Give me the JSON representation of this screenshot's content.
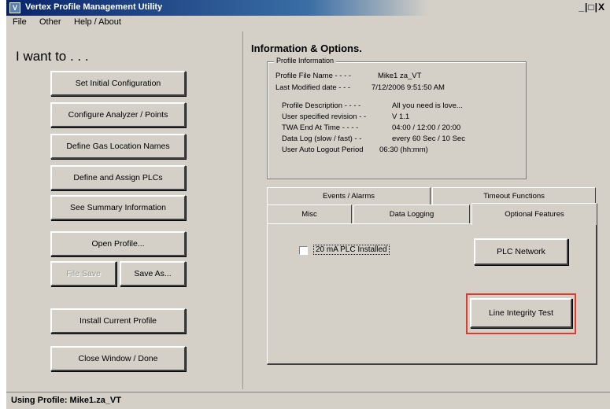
{
  "window": {
    "title": "Vertex Profile Management Utility",
    "controls": "_|□|X"
  },
  "menu": [
    {
      "label": "File"
    },
    {
      "label": "Other"
    },
    {
      "label": "Help / About"
    }
  ],
  "left": {
    "heading": "I want to . . .",
    "buttons": {
      "set_initial": "Set Initial Configuration",
      "configure": "Configure Analyzer / Points",
      "define_gas": "Define Gas Location Names",
      "define_plcs": "Define and Assign PLCs",
      "summary": "See Summary Information",
      "open_profile": "Open Profile...",
      "file_save": "File Save",
      "save_as": "Save As...",
      "install": "Install Current Profile",
      "close": "Close Window / Done"
    }
  },
  "right": {
    "title": "Information & Options.",
    "profile_info": {
      "legend": "Profile Information",
      "file_name_label": "Profile File Name - - - -",
      "file_name_value": "Mike1 za_VT",
      "modified_label": "Last Modified date - - -",
      "modified_value": "7/12/2006 9:51:50 AM",
      "description_label": "Profile Description - - - -",
      "description_value": "All you need is love...",
      "revision_label": "User specified revision - -",
      "revision_value": "V 1.1",
      "twa_label": "TWA End At Time - - - -",
      "twa_value": "04:00  /  12:00  /  20:00",
      "datalog_label": "Data Log (slow / fast) - -",
      "datalog_value": "every 60 Sec / 10 Sec",
      "logout_label": "User Auto Logout Period",
      "logout_value": "06:30 (hh:mm)"
    },
    "tabs": {
      "events": "Events / Alarms",
      "timeout": "Timeout Functions",
      "misc": "Misc",
      "datalogging": "Data Logging",
      "optional": "Optional Features"
    },
    "optional": {
      "checkbox_label": "20 mA PLC Installed",
      "checkbox_checked": false,
      "plc_network": "PLC Network",
      "line_integrity": "Line Integrity Test"
    }
  },
  "status": {
    "text": "Using Profile:  Mike1.za_VT"
  },
  "colors": {
    "highlight": "#e03a2e"
  }
}
